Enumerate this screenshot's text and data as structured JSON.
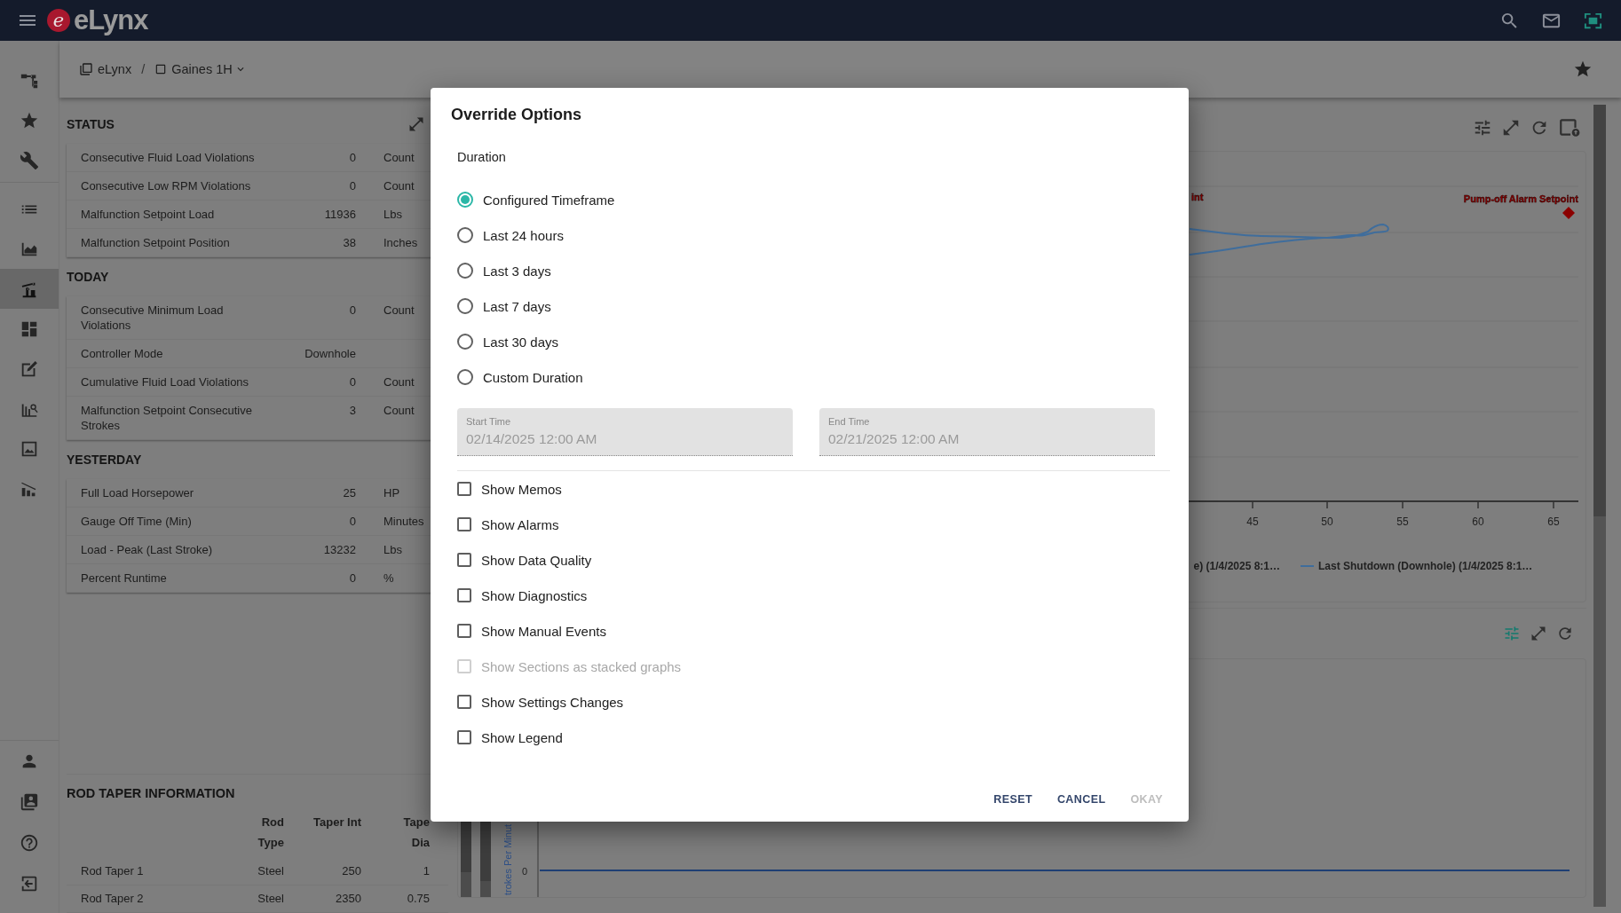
{
  "app_bar": {
    "logo_mark": "e",
    "logo_text": "eLynx"
  },
  "sidebar": {
    "items": [
      {
        "selected": false
      },
      {
        "selected": false
      },
      {
        "selected": false
      },
      {
        "selected": false
      },
      {
        "selected": false
      },
      {
        "selected": true
      },
      {
        "selected": false
      },
      {
        "selected": false
      },
      {
        "selected": false
      },
      {
        "selected": false
      },
      {
        "selected": false
      }
    ],
    "bottom_items": [
      {
        "selected": false
      },
      {
        "selected": false
      },
      {
        "selected": false
      },
      {
        "selected": false
      }
    ]
  },
  "breadcrumb": {
    "items": [
      {
        "label": "eLynx"
      },
      {
        "label": "Gaines 1H"
      }
    ],
    "separator": "/"
  },
  "status_card": {
    "sections": [
      {
        "title": "STATUS",
        "rows": [
          {
            "name": "Consecutive Fluid Load Violations",
            "value": "0",
            "unit": "Count"
          },
          {
            "name": "Consecutive Low RPM Violations",
            "value": "0",
            "unit": "Count"
          },
          {
            "name": "Malfunction Setpoint Load",
            "value": "11936",
            "unit": "Lbs"
          },
          {
            "name": "Malfunction Setpoint Position",
            "value": "38",
            "unit": "Inches"
          }
        ]
      },
      {
        "title": "TODAY",
        "rows": [
          {
            "name": "Consecutive Minimum Load Violations",
            "value": "0",
            "unit": "Count"
          },
          {
            "name": "Controller Mode",
            "value": "Downhole"
          },
          {
            "name": "Cumulative Fluid Load Violations",
            "value": "0",
            "unit": "Count"
          },
          {
            "name": "Malfunction Setpoint Consecutive Strokes",
            "value": "3",
            "unit": "Count"
          }
        ]
      },
      {
        "title": "YESTERDAY",
        "rows": [
          {
            "name": "Full Load Horsepower",
            "value": "25",
            "unit": "HP"
          },
          {
            "name": "Gauge Off Time (Min)",
            "value": "0",
            "unit": "Minutes"
          },
          {
            "name": "Load - Peak (Last Stroke)",
            "value": "13232",
            "unit": "Lbs"
          },
          {
            "name": "Percent Runtime",
            "value": "0",
            "unit": "%"
          }
        ]
      }
    ]
  },
  "rod_taper": {
    "title": "ROD TAPER INFORMATION",
    "columns": [
      "Rod Type",
      "Taper Int",
      "Tape Dia"
    ],
    "rows": [
      {
        "name": "Rod Taper 1",
        "cells": [
          "Steel",
          "250",
          "1"
        ]
      },
      {
        "name": "Rod Taper 2",
        "cells": [
          "Steel",
          "2350",
          "0.75"
        ]
      }
    ]
  },
  "chart_card": {
    "filter_active": false,
    "marker_label": "Pump-off Alarm Setpoint",
    "cut_label": "int",
    "x_tick_labels": [
      "45",
      "50",
      "55",
      "60",
      "65"
    ],
    "legend": [
      {
        "label": "e) (1/4/2025 8:1…"
      },
      {
        "label": "Last Shutdown (Downhole) (1/4/2025 8:1…"
      }
    ]
  },
  "rate_card": {
    "filter_active": true,
    "axis_label": "trokes Per Minut",
    "y_tick_label": "0"
  },
  "dialog": {
    "title": "Override Options",
    "duration_label": "Duration",
    "options": [
      {
        "label": "Configured Timeframe",
        "selected": true
      },
      {
        "label": "Last 24 hours",
        "selected": false
      },
      {
        "label": "Last 3 days",
        "selected": false
      },
      {
        "label": "Last 7 days",
        "selected": false
      },
      {
        "label": "Last 30 days",
        "selected": false
      },
      {
        "label": "Custom Duration",
        "selected": false
      }
    ],
    "fields": [
      {
        "label": "Start Time",
        "value": "02/14/2025 12:00 AM",
        "disabled": true
      },
      {
        "label": "End Time",
        "value": "02/21/2025 12:00 AM",
        "disabled": true
      }
    ],
    "checkboxes": [
      {
        "label": "Show Memos",
        "checked": false,
        "disabled": false
      },
      {
        "label": "Show Alarms",
        "checked": false,
        "disabled": false
      },
      {
        "label": "Show Data Quality",
        "checked": false,
        "disabled": false
      },
      {
        "label": "Show Diagnostics",
        "checked": false,
        "disabled": false
      },
      {
        "label": "Show Manual Events",
        "checked": false,
        "disabled": false
      },
      {
        "label": "Show Sections as stacked graphs",
        "checked": false,
        "disabled": true
      },
      {
        "label": "Show Settings Changes",
        "checked": false,
        "disabled": false
      },
      {
        "label": "Show Legend",
        "checked": false,
        "disabled": false
      }
    ],
    "buttons": [
      {
        "label": "RESET",
        "disabled": false
      },
      {
        "label": "CANCEL",
        "disabled": false
      },
      {
        "label": "OKAY",
        "disabled": true
      }
    ]
  }
}
